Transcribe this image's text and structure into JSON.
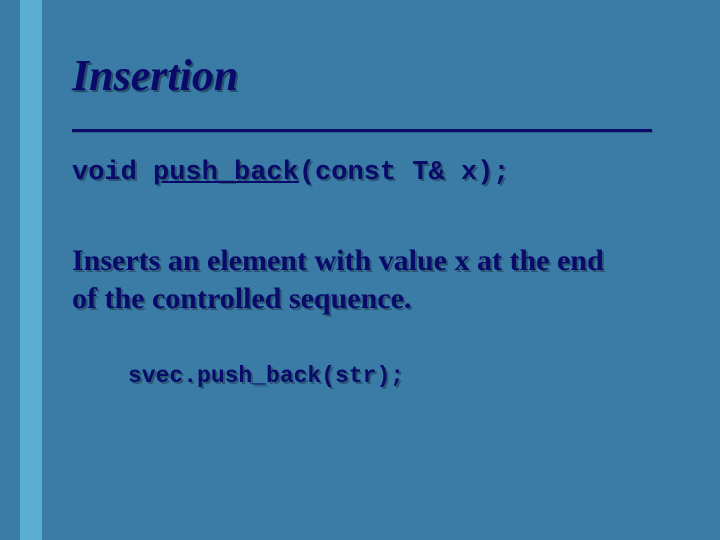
{
  "slide": {
    "title": "Insertion",
    "signature_pre": "void ",
    "signature_link": "push_back",
    "signature_post": "(const T& x);",
    "description": "Inserts an element with value x at the end of the controlled sequence.",
    "example": "svec.push_back(str);"
  }
}
